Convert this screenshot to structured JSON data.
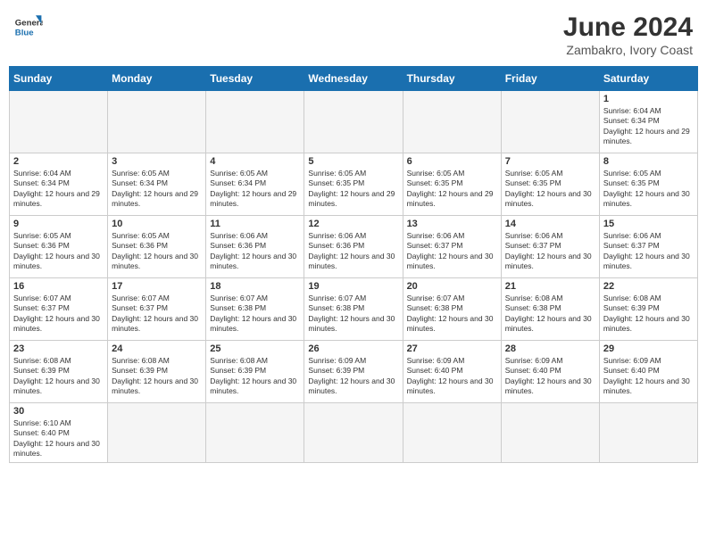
{
  "logo": {
    "text_general": "General",
    "text_blue": "Blue"
  },
  "title": "June 2024",
  "subtitle": "Zambakro, Ivory Coast",
  "days_of_week": [
    "Sunday",
    "Monday",
    "Tuesday",
    "Wednesday",
    "Thursday",
    "Friday",
    "Saturday"
  ],
  "weeks": [
    [
      {
        "day": "",
        "empty": true
      },
      {
        "day": "",
        "empty": true
      },
      {
        "day": "",
        "empty": true
      },
      {
        "day": "",
        "empty": true
      },
      {
        "day": "",
        "empty": true
      },
      {
        "day": "",
        "empty": true
      },
      {
        "day": "1",
        "sunrise": "6:04 AM",
        "sunset": "6:34 PM",
        "daylight": "12 hours and 29 minutes."
      }
    ],
    [
      {
        "day": "2",
        "sunrise": "6:04 AM",
        "sunset": "6:34 PM",
        "daylight": "12 hours and 29 minutes."
      },
      {
        "day": "3",
        "sunrise": "6:05 AM",
        "sunset": "6:34 PM",
        "daylight": "12 hours and 29 minutes."
      },
      {
        "day": "4",
        "sunrise": "6:05 AM",
        "sunset": "6:34 PM",
        "daylight": "12 hours and 29 minutes."
      },
      {
        "day": "5",
        "sunrise": "6:05 AM",
        "sunset": "6:35 PM",
        "daylight": "12 hours and 29 minutes."
      },
      {
        "day": "6",
        "sunrise": "6:05 AM",
        "sunset": "6:35 PM",
        "daylight": "12 hours and 29 minutes."
      },
      {
        "day": "7",
        "sunrise": "6:05 AM",
        "sunset": "6:35 PM",
        "daylight": "12 hours and 30 minutes."
      },
      {
        "day": "8",
        "sunrise": "6:05 AM",
        "sunset": "6:35 PM",
        "daylight": "12 hours and 30 minutes."
      }
    ],
    [
      {
        "day": "9",
        "sunrise": "6:05 AM",
        "sunset": "6:36 PM",
        "daylight": "12 hours and 30 minutes."
      },
      {
        "day": "10",
        "sunrise": "6:05 AM",
        "sunset": "6:36 PM",
        "daylight": "12 hours and 30 minutes."
      },
      {
        "day": "11",
        "sunrise": "6:06 AM",
        "sunset": "6:36 PM",
        "daylight": "12 hours and 30 minutes."
      },
      {
        "day": "12",
        "sunrise": "6:06 AM",
        "sunset": "6:36 PM",
        "daylight": "12 hours and 30 minutes."
      },
      {
        "day": "13",
        "sunrise": "6:06 AM",
        "sunset": "6:37 PM",
        "daylight": "12 hours and 30 minutes."
      },
      {
        "day": "14",
        "sunrise": "6:06 AM",
        "sunset": "6:37 PM",
        "daylight": "12 hours and 30 minutes."
      },
      {
        "day": "15",
        "sunrise": "6:06 AM",
        "sunset": "6:37 PM",
        "daylight": "12 hours and 30 minutes."
      }
    ],
    [
      {
        "day": "16",
        "sunrise": "6:07 AM",
        "sunset": "6:37 PM",
        "daylight": "12 hours and 30 minutes."
      },
      {
        "day": "17",
        "sunrise": "6:07 AM",
        "sunset": "6:37 PM",
        "daylight": "12 hours and 30 minutes."
      },
      {
        "day": "18",
        "sunrise": "6:07 AM",
        "sunset": "6:38 PM",
        "daylight": "12 hours and 30 minutes."
      },
      {
        "day": "19",
        "sunrise": "6:07 AM",
        "sunset": "6:38 PM",
        "daylight": "12 hours and 30 minutes."
      },
      {
        "day": "20",
        "sunrise": "6:07 AM",
        "sunset": "6:38 PM",
        "daylight": "12 hours and 30 minutes."
      },
      {
        "day": "21",
        "sunrise": "6:08 AM",
        "sunset": "6:38 PM",
        "daylight": "12 hours and 30 minutes."
      },
      {
        "day": "22",
        "sunrise": "6:08 AM",
        "sunset": "6:39 PM",
        "daylight": "12 hours and 30 minutes."
      }
    ],
    [
      {
        "day": "23",
        "sunrise": "6:08 AM",
        "sunset": "6:39 PM",
        "daylight": "12 hours and 30 minutes."
      },
      {
        "day": "24",
        "sunrise": "6:08 AM",
        "sunset": "6:39 PM",
        "daylight": "12 hours and 30 minutes."
      },
      {
        "day": "25",
        "sunrise": "6:08 AM",
        "sunset": "6:39 PM",
        "daylight": "12 hours and 30 minutes."
      },
      {
        "day": "26",
        "sunrise": "6:09 AM",
        "sunset": "6:39 PM",
        "daylight": "12 hours and 30 minutes."
      },
      {
        "day": "27",
        "sunrise": "6:09 AM",
        "sunset": "6:40 PM",
        "daylight": "12 hours and 30 minutes."
      },
      {
        "day": "28",
        "sunrise": "6:09 AM",
        "sunset": "6:40 PM",
        "daylight": "12 hours and 30 minutes."
      },
      {
        "day": "29",
        "sunrise": "6:09 AM",
        "sunset": "6:40 PM",
        "daylight": "12 hours and 30 minutes."
      }
    ],
    [
      {
        "day": "30",
        "sunrise": "6:10 AM",
        "sunset": "6:40 PM",
        "daylight": "12 hours and 30 minutes."
      },
      {
        "day": "",
        "empty": true
      },
      {
        "day": "",
        "empty": true
      },
      {
        "day": "",
        "empty": true
      },
      {
        "day": "",
        "empty": true
      },
      {
        "day": "",
        "empty": true
      },
      {
        "day": "",
        "empty": true
      }
    ]
  ]
}
